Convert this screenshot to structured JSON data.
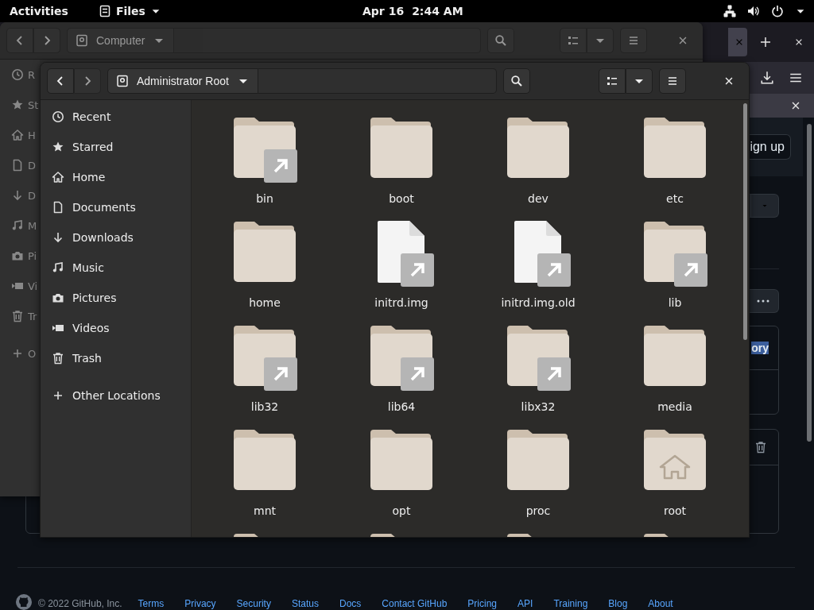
{
  "top_bar": {
    "activities": "Activities",
    "app_name": "Files",
    "date": "Apr 16",
    "time": "2:44 AM"
  },
  "browser": {
    "page": {
      "sign_up": "ign up",
      "selected_text": "ory",
      "footer": {
        "copyright": "© 2022 GitHub, Inc.",
        "links": [
          "Terms",
          "Privacy",
          "Security",
          "Status",
          "Docs",
          "Contact GitHub",
          "Pricing",
          "API",
          "Training",
          "Blog",
          "About"
        ]
      }
    }
  },
  "back_window": {
    "location": "Computer",
    "sidebar": [
      {
        "kind": "recent",
        "label": "R"
      },
      {
        "kind": "starred",
        "label": "St"
      },
      {
        "kind": "home",
        "label": "H"
      },
      {
        "kind": "documents",
        "label": "D"
      },
      {
        "kind": "downloads",
        "label": "D"
      },
      {
        "kind": "music",
        "label": "M"
      },
      {
        "kind": "pictures",
        "label": "Pi"
      },
      {
        "kind": "videos",
        "label": "Vi"
      },
      {
        "kind": "trash",
        "label": "Tr"
      },
      {
        "kind": "other",
        "label": "O"
      }
    ]
  },
  "front_window": {
    "location": "Administrator Root",
    "sidebar": [
      {
        "kind": "recent",
        "label": "Recent"
      },
      {
        "kind": "starred",
        "label": "Starred"
      },
      {
        "kind": "home",
        "label": "Home"
      },
      {
        "kind": "documents",
        "label": "Documents"
      },
      {
        "kind": "downloads",
        "label": "Downloads"
      },
      {
        "kind": "music",
        "label": "Music"
      },
      {
        "kind": "pictures",
        "label": "Pictures"
      },
      {
        "kind": "videos",
        "label": "Videos"
      },
      {
        "kind": "trash",
        "label": "Trash"
      },
      {
        "kind": "other",
        "label": "Other Locations"
      }
    ],
    "items": [
      {
        "name": "bin",
        "kind": "folder",
        "link": true
      },
      {
        "name": "boot",
        "kind": "folder",
        "link": false
      },
      {
        "name": "dev",
        "kind": "folder",
        "link": false
      },
      {
        "name": "etc",
        "kind": "folder",
        "link": false
      },
      {
        "name": "home",
        "kind": "folder",
        "link": false
      },
      {
        "name": "initrd.img",
        "kind": "file",
        "link": true
      },
      {
        "name": "initrd.img.old",
        "kind": "file",
        "link": true
      },
      {
        "name": "lib",
        "kind": "folder",
        "link": true
      },
      {
        "name": "lib32",
        "kind": "folder",
        "link": true
      },
      {
        "name": "lib64",
        "kind": "folder",
        "link": true
      },
      {
        "name": "libx32",
        "kind": "folder",
        "link": true
      },
      {
        "name": "media",
        "kind": "folder",
        "link": false
      },
      {
        "name": "mnt",
        "kind": "folder",
        "link": false
      },
      {
        "name": "opt",
        "kind": "folder",
        "link": false
      },
      {
        "name": "proc",
        "kind": "folder",
        "link": false
      },
      {
        "name": "root",
        "kind": "home-folder",
        "link": false
      },
      {
        "kind": "folder",
        "link": false
      },
      {
        "kind": "folder",
        "link": false
      },
      {
        "kind": "folder",
        "link": false
      },
      {
        "kind": "folder",
        "link": false
      }
    ]
  }
}
